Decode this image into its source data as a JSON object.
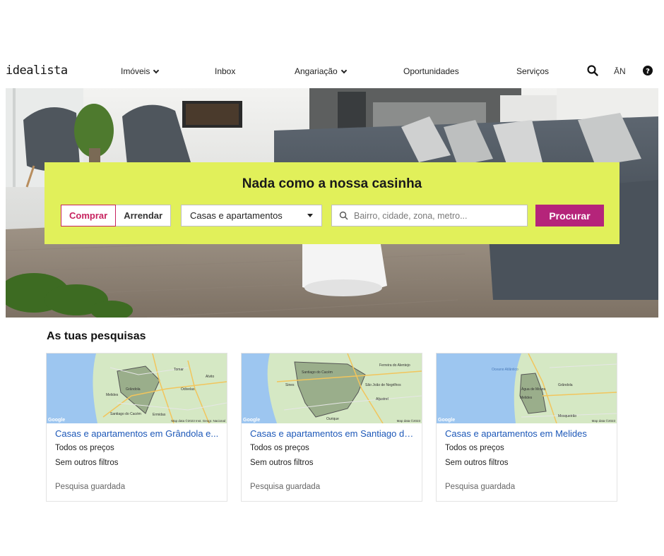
{
  "header": {
    "logo": "idealista",
    "nav": [
      {
        "label": "Imóveis",
        "dropdown": true
      },
      {
        "label": "Inbox",
        "dropdown": false
      },
      {
        "label": "Angariação",
        "dropdown": true
      },
      {
        "label": "Oportunidades",
        "dropdown": false
      },
      {
        "label": "Serviços",
        "dropdown": false
      }
    ],
    "language": "ĀN",
    "icons": [
      "search-icon",
      "help-icon"
    ]
  },
  "hero": {
    "title": "Nada como a nossa casinha",
    "toggle": {
      "buy": "Comprar",
      "rent": "Arrendar",
      "selected": "buy"
    },
    "property_type": "Casas e apartamentos",
    "search_placeholder": "Bairro, cidade, zona, metro...",
    "search_button": "Procurar"
  },
  "saved": {
    "title": "As tuas pesquisas",
    "cards": [
      {
        "title": "Casas e apartamentos em Grândola e...",
        "price": "Todos os preços",
        "filters": "Sem outros filtros",
        "status": "Pesquisa guardada",
        "map_labels": [
          "Grândola",
          "Melides",
          "Tomar",
          "Alvito",
          "Odivelas",
          "Santiago do Cacém",
          "Ermidas"
        ],
        "map_footer": "Map data ©2023 Inst. Geogr. Nacional",
        "map_brand": "Google"
      },
      {
        "title": "Casas e apartamentos em Santiago do...",
        "price": "Todos os preços",
        "filters": "Sem outros filtros",
        "status": "Pesquisa guardada",
        "map_labels": [
          "Santiago do Cacém",
          "Ferreira do Alentejo",
          "Sines",
          "São João de Negrilhos",
          "Aljustrel",
          "Ourique"
        ],
        "map_footer": "Map data ©2023",
        "map_brand": "Google"
      },
      {
        "title": "Casas e apartamentos em Melides",
        "price": "Todos os preços",
        "filters": "Sem outros filtros",
        "status": "Pesquisa guardada",
        "map_labels": [
          "Oceano Atlântico",
          "Grândola",
          "Água de Moura",
          "Melides",
          "Mosqueirão"
        ],
        "map_footer": "Map data ©2023",
        "map_brand": "Google"
      }
    ]
  },
  "colors": {
    "accent_pink": "#b5247a",
    "toggle_pink": "#c7235f",
    "panel_lime": "#e1f05a",
    "link_blue": "#1d58b8"
  }
}
